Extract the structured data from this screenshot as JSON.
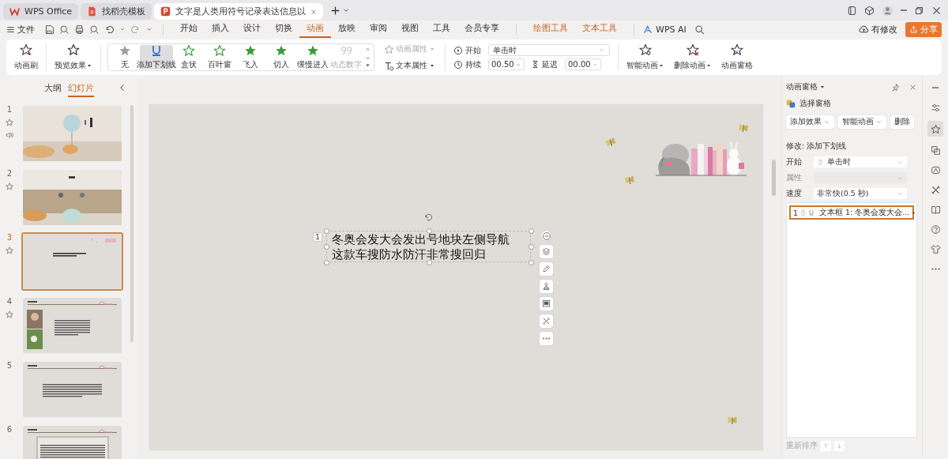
{
  "title_tabs": [
    {
      "label": "WPS Office",
      "kind": "home",
      "selected": false
    },
    {
      "label": "找稻壳模板",
      "kind": "template",
      "selected": false
    },
    {
      "label": "文字是人类用符号记录表达信息以",
      "kind": "presentation",
      "selected": true
    }
  ],
  "menu": {
    "file": "文件",
    "tabs": [
      {
        "label": "开始",
        "kind": "normal",
        "selected": false
      },
      {
        "label": "插入",
        "kind": "normal",
        "selected": false
      },
      {
        "label": "设计",
        "kind": "normal",
        "selected": false
      },
      {
        "label": "切换",
        "kind": "normal",
        "selected": false
      },
      {
        "label": "动画",
        "kind": "normal",
        "selected": true
      },
      {
        "label": "放映",
        "kind": "normal",
        "selected": false
      },
      {
        "label": "审阅",
        "kind": "normal",
        "selected": false
      },
      {
        "label": "视图",
        "kind": "normal",
        "selected": false
      },
      {
        "label": "工具",
        "kind": "normal",
        "selected": false
      },
      {
        "label": "会员专享",
        "kind": "normal",
        "selected": false
      },
      {
        "label": "绘图工具",
        "kind": "context",
        "selected": false
      },
      {
        "label": "文本工具",
        "kind": "context",
        "selected": false
      }
    ],
    "ai": "WPS AI"
  },
  "account": {
    "modified": "有修改",
    "share": "分享"
  },
  "ribbon": {
    "brush": "动画刷",
    "preview": "预览效果",
    "effects": [
      {
        "label": "无",
        "kind": "none",
        "selected": false,
        "disabled": false
      },
      {
        "label": "添加下划线",
        "kind": "underline",
        "selected": true,
        "disabled": false
      },
      {
        "label": "盒状",
        "kind": "star",
        "selected": false,
        "disabled": false
      },
      {
        "label": "百叶窗",
        "kind": "star",
        "selected": false,
        "disabled": false
      },
      {
        "label": "飞入",
        "kind": "star-filled",
        "selected": false,
        "disabled": false
      },
      {
        "label": "切入",
        "kind": "star-filled",
        "selected": false,
        "disabled": false
      },
      {
        "label": "缓慢进入",
        "kind": "star-filled",
        "selected": false,
        "disabled": false
      },
      {
        "label": "动态数字",
        "kind": "number",
        "selected": false,
        "disabled": true
      }
    ],
    "props": [
      {
        "label": "动画属性",
        "kind": "anim",
        "disabled": true
      },
      {
        "label": "文本属性",
        "kind": "text",
        "disabled": false
      }
    ],
    "timing": {
      "start_label": "开始",
      "start_value": "单击时",
      "duration_label": "持续",
      "duration_value": "00.50",
      "delay_label": "延迟",
      "delay_value": "00.00"
    },
    "actions": [
      {
        "label": "智能动画",
        "kind": "smart",
        "dropdown": true
      },
      {
        "label": "删除动画",
        "kind": "delete",
        "dropdown": true
      },
      {
        "label": "动画窗格",
        "kind": "pane",
        "dropdown": false
      }
    ]
  },
  "slide_panel": {
    "tabs": [
      {
        "label": "大纲",
        "selected": false
      },
      {
        "label": "幻灯片",
        "selected": true
      }
    ],
    "slides": [
      {
        "number": "1",
        "kind": "cover",
        "selected": false,
        "animated": true,
        "sound": true
      },
      {
        "number": "2",
        "kind": "contents",
        "selected": false,
        "animated": true,
        "sound": false
      },
      {
        "number": "3",
        "kind": "text",
        "selected": true,
        "animated": true,
        "sound": false
      },
      {
        "number": "4",
        "kind": "image-text",
        "selected": false,
        "animated": true,
        "sound": false
      },
      {
        "number": "5",
        "kind": "heading-text",
        "selected": false,
        "animated": false,
        "sound": false
      },
      {
        "number": "6",
        "kind": "heading-box",
        "selected": false,
        "animated": false,
        "sound": false
      }
    ]
  },
  "slide": {
    "tag": "1",
    "text": "冬奥会发大会发出号地块左侧导航这款车搜防水防汗非常搜回归",
    "float_tools": [
      {
        "kind": "collapse"
      },
      {
        "kind": "layers"
      },
      {
        "kind": "pen"
      },
      {
        "kind": "stamp"
      },
      {
        "kind": "frame"
      },
      {
        "kind": "tools"
      },
      {
        "kind": "more"
      }
    ]
  },
  "animation_pane": {
    "title": "动画窗格",
    "select_pane": "选择窗格",
    "buttons": [
      {
        "label": "添加效果",
        "dropdown": true
      },
      {
        "label": "智能动画",
        "dropdown": true
      },
      {
        "label": "删除",
        "dropdown": false
      }
    ],
    "modify": "修改: 添加下划线",
    "fields": [
      {
        "label": "开始",
        "value": "单击时",
        "kind": "trigger",
        "disabled": false
      },
      {
        "label": "属性",
        "kind": "plain",
        "disabled": true
      },
      {
        "label": "速度",
        "value": "非常快(0.5 秒)",
        "kind": "plain",
        "disabled": false
      }
    ],
    "items": [
      {
        "order": "1",
        "target": "文本框 1: 冬奥会发大会...",
        "selected": true
      }
    ],
    "reorder": "重新排序"
  },
  "side_tools": [
    {
      "kind": "collapse",
      "selected": false
    },
    {
      "kind": "sliders",
      "selected": false
    },
    {
      "kind": "star",
      "selected": true
    },
    {
      "kind": "copy",
      "selected": false
    },
    {
      "kind": "transition",
      "selected": false
    },
    {
      "kind": "tools",
      "selected": false
    },
    {
      "kind": "book",
      "selected": false
    },
    {
      "kind": "help",
      "selected": false
    },
    {
      "kind": "shirt",
      "selected": false
    },
    {
      "kind": "more",
      "selected": false
    }
  ]
}
